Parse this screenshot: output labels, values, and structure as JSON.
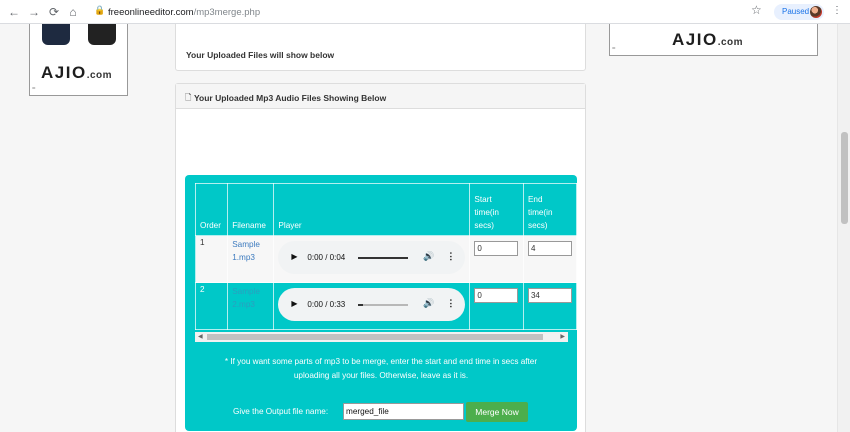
{
  "browser": {
    "url_host": "freeonlineeditor.com",
    "url_path": "/mp3merge.php",
    "paused_label": "Paused"
  },
  "ads": {
    "brand": "AJIO",
    "brand_suffix": ".com",
    "ad_marker": "="
  },
  "upload_panel": {
    "text": "Your Uploaded Files will show below"
  },
  "audio_panel": {
    "title": "Your Uploaded Mp3 Audio Files Showing Below",
    "table": {
      "headers": {
        "order": "Order",
        "filename": "Filename",
        "player": "Player",
        "start_l1": "Start",
        "start_l2": "time(in",
        "start_l3": "secs)",
        "end_l1": "End",
        "end_l2": "time(in",
        "end_l3": "secs)"
      },
      "rows": [
        {
          "order": "1",
          "filename_l1": "Sample",
          "filename_l2": "1.mp3",
          "time": "0:00 / 0:04",
          "progress": 1.0,
          "start": "0",
          "end": "4"
        },
        {
          "order": "2",
          "filename_l1": "Sample",
          "filename_l2": "2.mp3",
          "time": "0:00 / 0:33",
          "progress": 0.1,
          "start": "0",
          "end": "34"
        }
      ]
    },
    "note_l1": "* If you want some parts of mp3 to be merge, enter the start and end time in secs after",
    "note_l2": "uploading all your files. Otherwise, leave as it is.",
    "output_label": "Give the Output file name:",
    "output_value": "merged_file",
    "merge_button": "Merge Now"
  },
  "colors": {
    "teal": "#00c8c8",
    "merge_button": "#4cae4c"
  }
}
